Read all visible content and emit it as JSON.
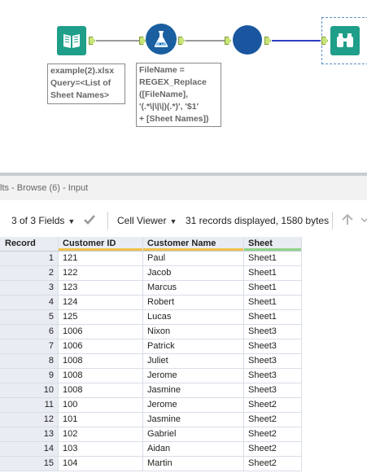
{
  "canvas": {
    "annotation_input": [
      "example(2).xlsx",
      "Query=<List of",
      "Sheet Names>"
    ],
    "annotation_formula": "FileName =\nREGEX_Replace\n([FileName],\n'(.*\\|\\|\\|)(.*)', '$1'\n+ [Sheet Names])",
    "colors": {
      "tool_teal": "#1f9e8a",
      "tool_blue": "#1b5fa0",
      "anchor_green": "#c8e57a",
      "connector_gray": "#9a9a9a",
      "connector_blue": "#2f3fbf"
    }
  },
  "results": {
    "title": "lts - Browse (6) - Input",
    "fields_label": "3 of 3 Fields",
    "cell_viewer_label": "Cell Viewer",
    "records_info": "31 records displayed, 1580 bytes"
  },
  "table": {
    "headers": [
      "Record",
      "Customer ID",
      "Customer Name",
      "Sheet"
    ],
    "rows": [
      [
        "1",
        "121",
        "Paul",
        "Sheet1"
      ],
      [
        "2",
        "122",
        "Jacob",
        "Sheet1"
      ],
      [
        "3",
        "123",
        "Marcus",
        "Sheet1"
      ],
      [
        "4",
        "124",
        "Robert",
        "Sheet1"
      ],
      [
        "5",
        "125",
        "Lucas",
        "Sheet1"
      ],
      [
        "6",
        "1006",
        "Nixon",
        "Sheet3"
      ],
      [
        "7",
        "1006",
        "Patrick",
        "Sheet3"
      ],
      [
        "8",
        "1008",
        "Juliet",
        "Sheet3"
      ],
      [
        "9",
        "1008",
        "Jerome",
        "Sheet3"
      ],
      [
        "10",
        "1008",
        "Jasmine",
        "Sheet3"
      ],
      [
        "11",
        "100",
        "Jerome",
        "Sheet2"
      ],
      [
        "12",
        "101",
        "Jasmine",
        "Sheet2"
      ],
      [
        "13",
        "102",
        "Gabriel",
        "Sheet2"
      ],
      [
        "14",
        "103",
        "Aidan",
        "Sheet2"
      ],
      [
        "15",
        "104",
        "Martin",
        "Sheet2"
      ]
    ]
  }
}
